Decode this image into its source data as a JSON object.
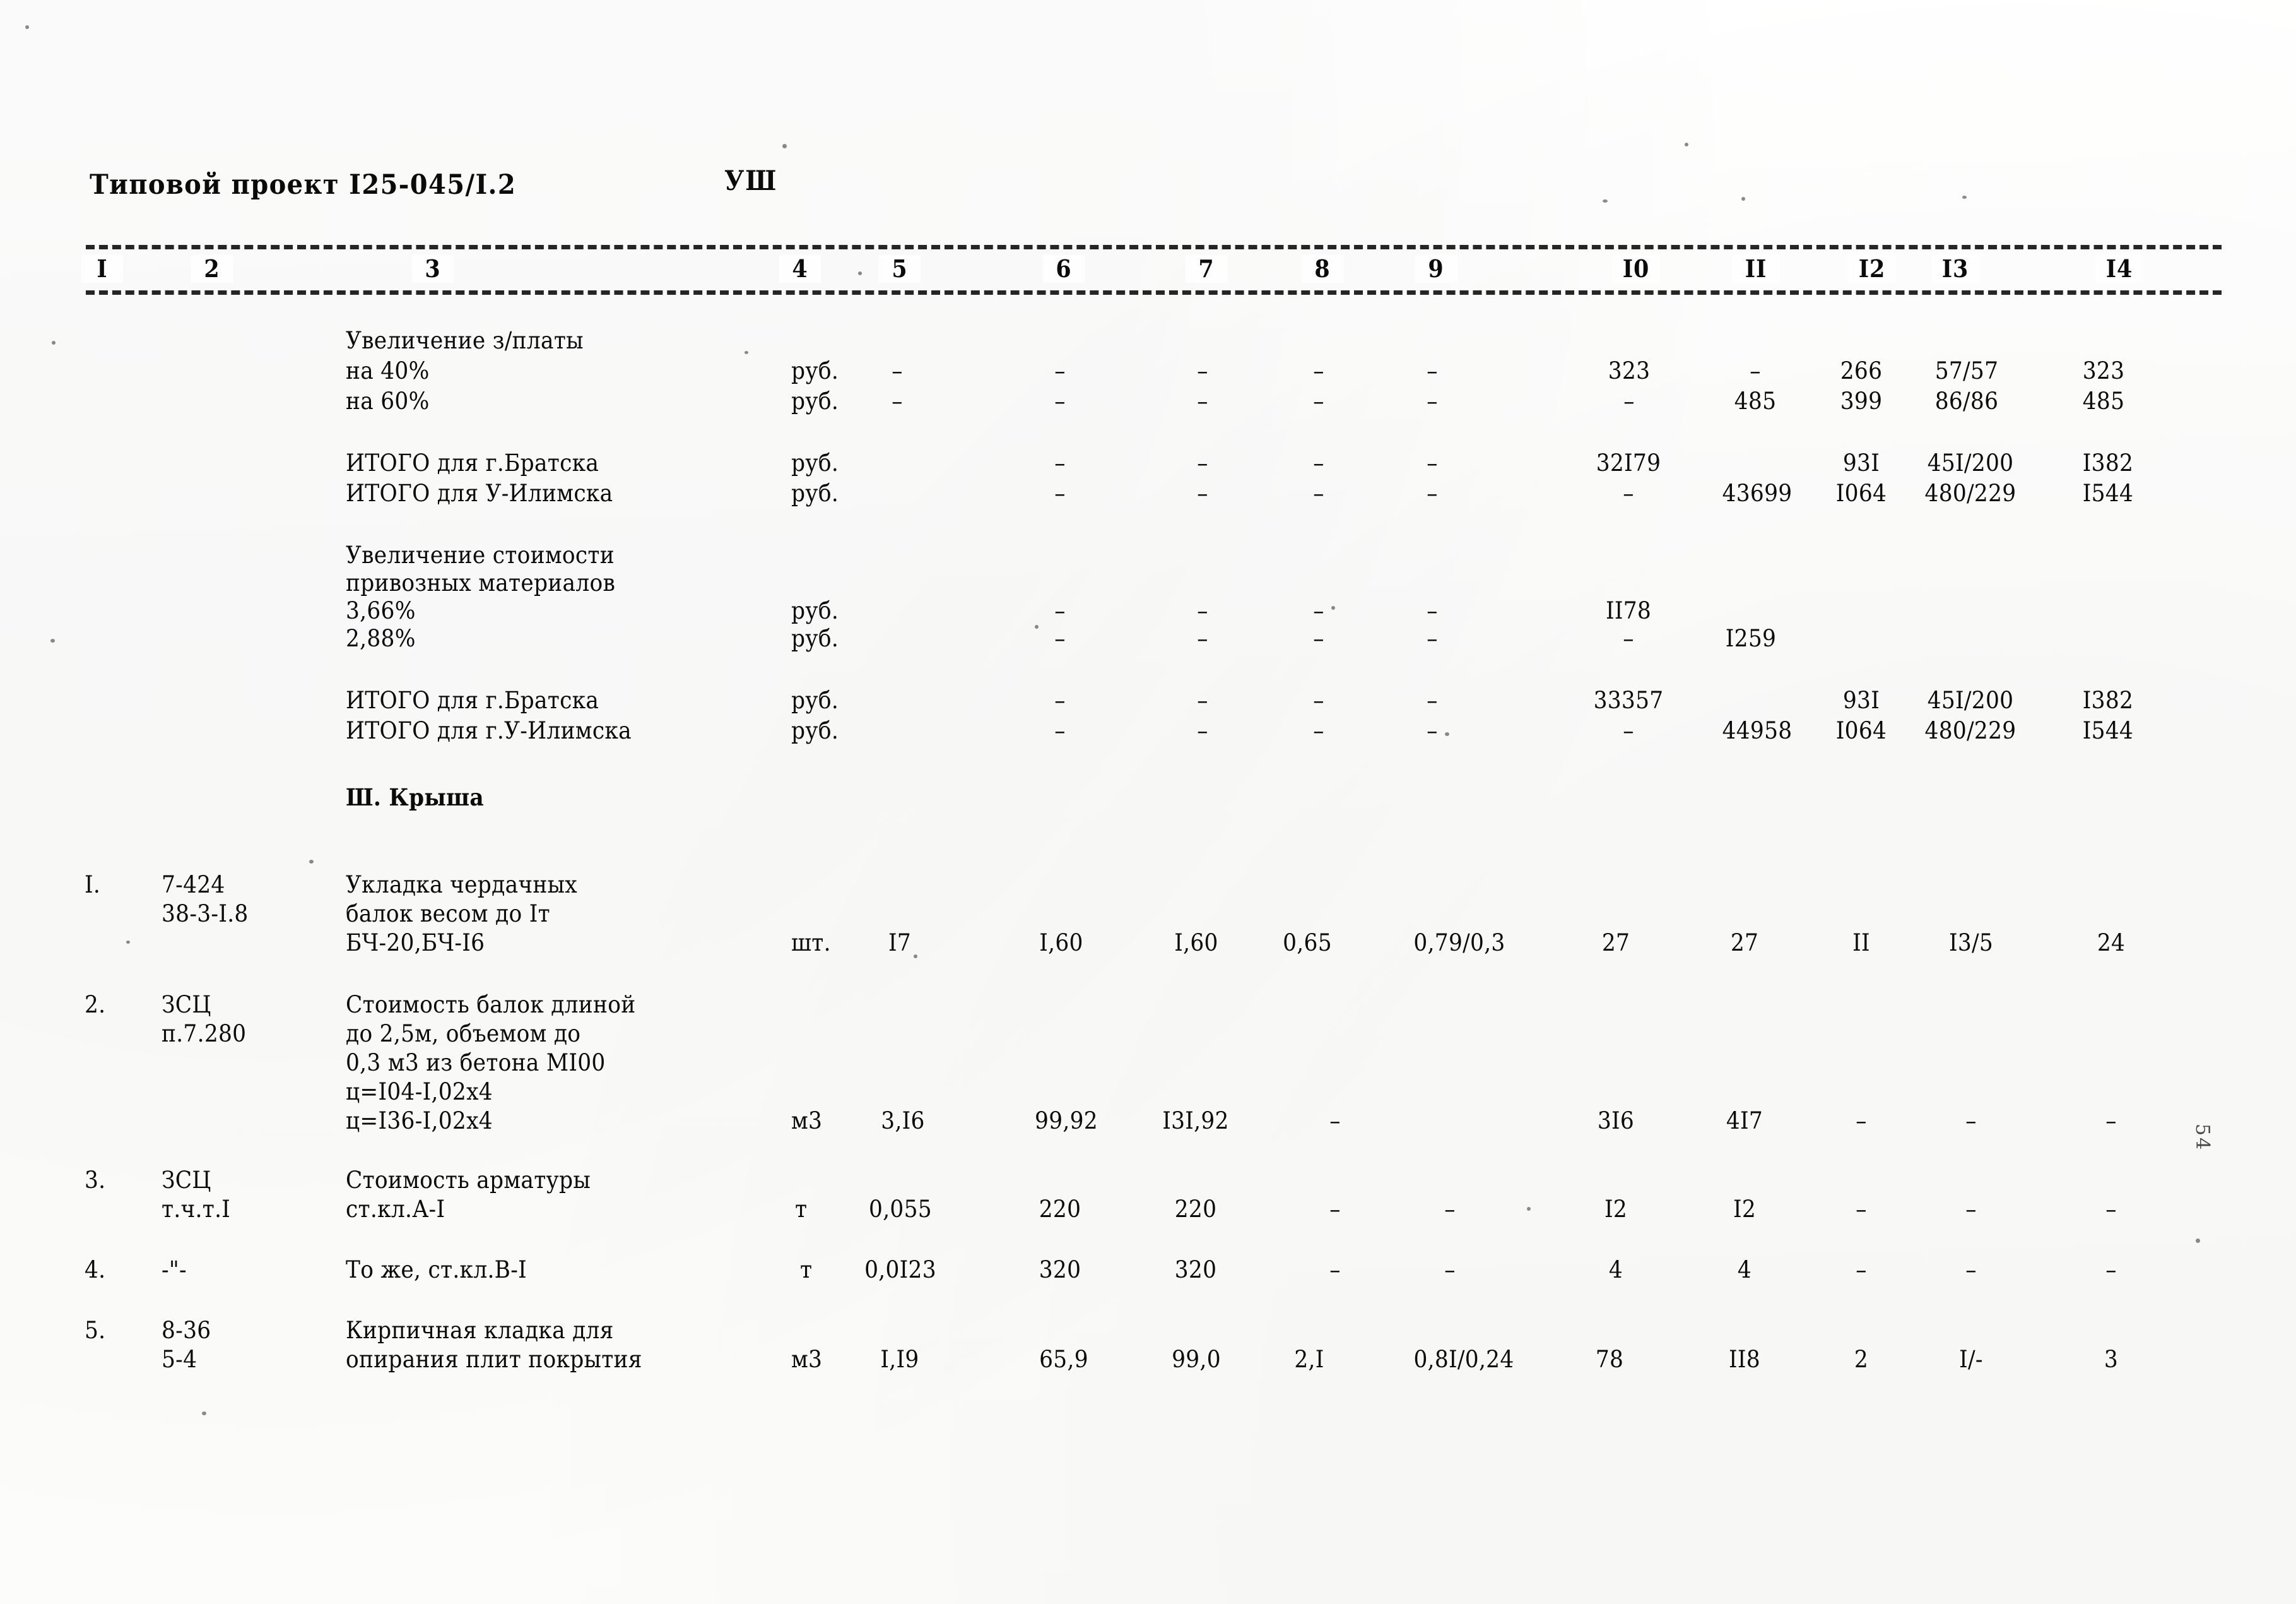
{
  "header": {
    "title": "Типовой проект I25-045/I.2",
    "sheet_number": "УШ"
  },
  "table": {
    "column_headers": [
      "I",
      "2",
      "3",
      "4",
      "5",
      "6",
      "7",
      "8",
      "9",
      "I0",
      "II",
      "I2",
      "I3",
      "I4"
    ],
    "section_title": "Ш. Крыша",
    "groups": [
      {
        "name": "salary-increase",
        "caption": "Увеличение з/платы",
        "rows": [
          {
            "label": "на 40%",
            "unit": "руб.",
            "values": [
              "–",
              "–",
              "–",
              "–",
              "–",
              "323",
              "–",
              "266",
              "57/57",
              "323"
            ]
          },
          {
            "label": "на 60%",
            "unit": "руб.",
            "values": [
              "–",
              "–",
              "–",
              "–",
              "–",
              "–",
              "485",
              "399",
              "86/86",
              "485"
            ]
          }
        ]
      },
      {
        "name": "totals-first",
        "caption": "",
        "rows": [
          {
            "label": "ИТОГО для г.Братска",
            "unit": "руб.",
            "values": [
              "",
              "–",
              "–",
              "–",
              "–",
              "32I79",
              "",
              "93I",
              "45I/200",
              "I382"
            ]
          },
          {
            "label": "ИТОГО для У-Илимска",
            "unit": "руб.",
            "values": [
              "",
              "–",
              "–",
              "–",
              "–",
              "–",
              "43699",
              "I064",
              "480/229",
              "I544"
            ]
          }
        ]
      },
      {
        "name": "imported-materials-increase",
        "caption": "Увеличение стоимости\nпривозных материалов",
        "rows": [
          {
            "label": "3,66%",
            "unit": "руб.",
            "values": [
              "",
              "–",
              "–",
              "–",
              "–",
              "II78",
              "",
              "",
              "",
              ""
            ]
          },
          {
            "label": "2,88%",
            "unit": "руб.",
            "values": [
              "",
              "–",
              "–",
              "–",
              "–",
              "–",
              "I259",
              "",
              "",
              ""
            ]
          }
        ]
      },
      {
        "name": "totals-second",
        "caption": "",
        "rows": [
          {
            "label": "ИТОГО для г.Братска",
            "unit": "руб.",
            "values": [
              "",
              "–",
              "–",
              "–",
              "–",
              "33357",
              "",
              "93I",
              "45I/200",
              "I382"
            ]
          },
          {
            "label": "ИТОГО для г.У-Илимска",
            "unit": "руб.",
            "values": [
              "",
              "–",
              "–",
              "–",
              "–",
              "–",
              "44958",
              "I064",
              "480/229",
              "I544"
            ]
          }
        ]
      }
    ],
    "items": [
      {
        "no": "I.",
        "code_lines": [
          "7-424",
          "38-3-I.8"
        ],
        "desc_lines": [
          "Укладка чердачных",
          "балок весом до Iт",
          "БЧ-20,БЧ-I6"
        ],
        "unit": "шт.",
        "qty": "I7",
        "values": [
          "I,60",
          "I,60",
          "0,65",
          "0,79/0,3",
          "27",
          "27",
          "II",
          "I3/5",
          "24"
        ]
      },
      {
        "no": "2.",
        "code_lines": [
          "ЗСЦ",
          "п.7.280"
        ],
        "desc_lines": [
          "Стоимость балок длиной",
          "до 2,5м, объемом до",
          "0,3 м3 из бетона МI00",
          "ц=I04-I,02х4",
          "ц=I36-I,02х4"
        ],
        "unit": "м3",
        "qty": "3,I6",
        "values": [
          "99,92",
          "I3I,92",
          "–",
          "",
          "3I6",
          "4I7",
          "–",
          "–",
          "–"
        ]
      },
      {
        "no": "3.",
        "code_lines": [
          "ЗСЦ",
          "т.ч.т.I"
        ],
        "desc_lines": [
          "Стоимость арматуры",
          "ст.кл.А-I"
        ],
        "unit": "т",
        "qty": "0,055",
        "values": [
          "220",
          "220",
          "–",
          "–",
          "I2",
          "I2",
          "–",
          "–",
          "–"
        ]
      },
      {
        "no": "4.",
        "code_lines": [
          "-\"-"
        ],
        "desc_lines": [
          "То же, ст.кл.В-I"
        ],
        "unit": "т",
        "qty": "0,0I23",
        "values": [
          "320",
          "320",
          "–",
          "–",
          "4",
          "4",
          "–",
          "–",
          "–"
        ]
      },
      {
        "no": "5.",
        "code_lines": [
          "8-36",
          "5-4"
        ],
        "desc_lines": [
          "Кирпичная кладка для",
          "опирания плит покрытия"
        ],
        "unit": "м3",
        "qty": "I,I9",
        "values": [
          "65,9",
          "99,0",
          "2,I",
          "0,8I/0,24",
          "78",
          "II8",
          "2",
          "I/-",
          "3"
        ]
      }
    ]
  },
  "margin_marks": {
    "page_side_note": "54"
  }
}
